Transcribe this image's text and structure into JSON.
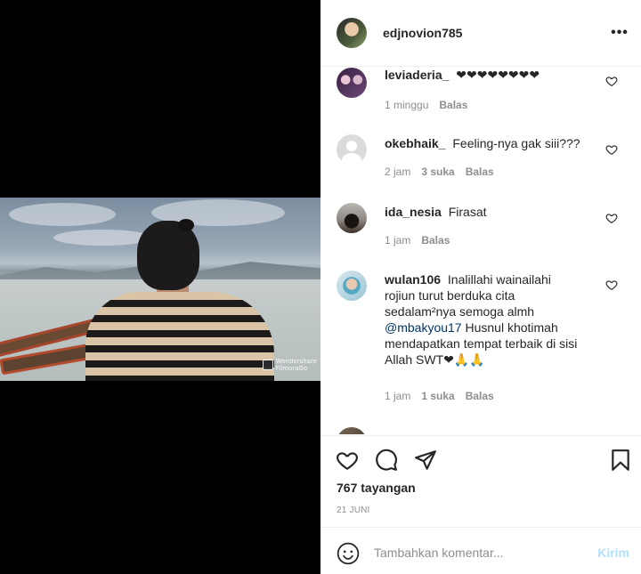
{
  "post": {
    "username": "edjnovion785",
    "more_label": "•••",
    "watermark": [
      "Wondershare",
      "FilmoraGo"
    ]
  },
  "comments": [
    {
      "username": "leviaderia_",
      "text": "❤❤❤❤❤❤❤❤",
      "time": "1 minggu",
      "likes": "",
      "reply": "Balas"
    },
    {
      "username": "okebhaik_",
      "text": "Feeling-nya gak siii???",
      "time": "2 jam",
      "likes": "3 suka",
      "reply": "Balas"
    },
    {
      "username": "ida_nesia",
      "text": "Firasat",
      "time": "1 jam",
      "likes": "",
      "reply": "Balas"
    },
    {
      "username": "wulan106",
      "text_before": "Inalillahi wainailahi rojiun turut berduka cita sedalam²nya semoga almh ",
      "mention": "@mbakyou17",
      "text_after": " Husnul khotimah mendapatkan tempat terbaik di sisi Allah SWT❤🙏🙏",
      "time": "1 jam",
      "likes": "1 suka",
      "reply": "Balas"
    }
  ],
  "stats": {
    "views": "767 tayangan",
    "date": "21 JUNI"
  },
  "add_comment": {
    "placeholder": "Tambahkan komentar...",
    "post_label": "Kirim"
  },
  "colors": {
    "link": "#003569",
    "post_button_disabled": "#b2dffc",
    "secondary_text": "#8e8e8e"
  },
  "icons": [
    "heart-icon",
    "comment-icon",
    "share-icon",
    "bookmark-icon",
    "emoji-icon",
    "more-icon"
  ]
}
